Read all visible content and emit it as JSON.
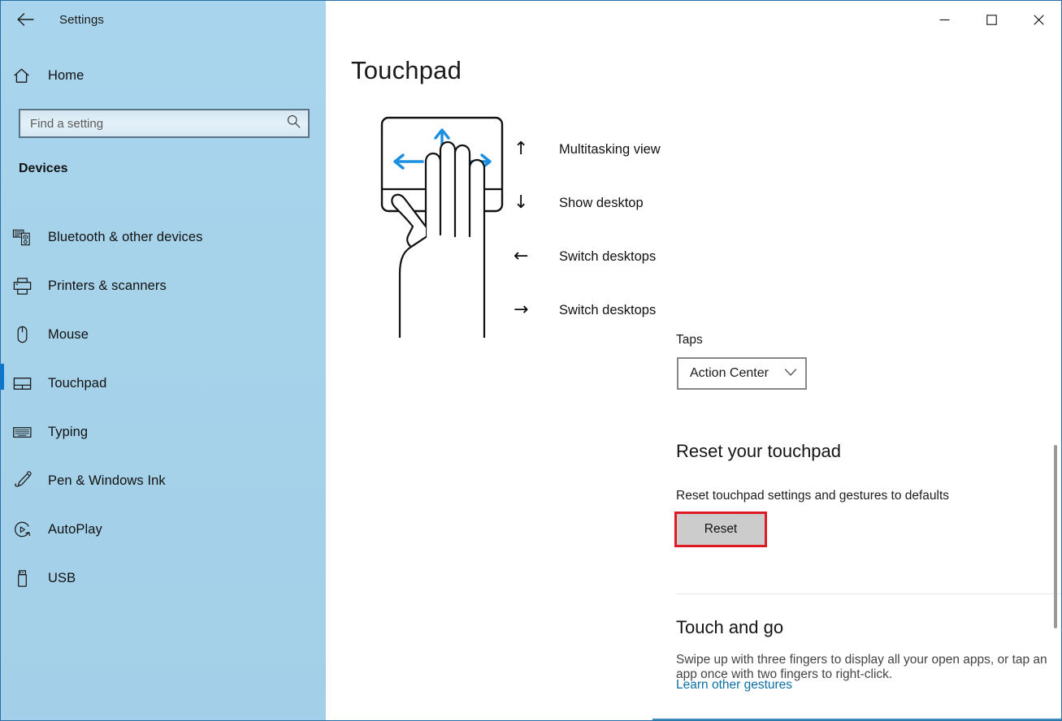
{
  "window": {
    "app_title": "Settings",
    "back_icon": "back-arrow-icon",
    "controls": {
      "minimize_label": "—",
      "maximize_label": "☐",
      "close_label": "✕"
    }
  },
  "sidebar": {
    "home": {
      "label": "Home",
      "icon": "home-icon"
    },
    "search": {
      "placeholder": "Find a setting",
      "value": "",
      "icon": "search-icon"
    },
    "group_header": "Devices",
    "items": [
      {
        "label": "Bluetooth & other devices",
        "icon": "bluetooth-devices-icon",
        "selected": false
      },
      {
        "label": "Printers & scanners",
        "icon": "printer-icon",
        "selected": false
      },
      {
        "label": "Mouse",
        "icon": "mouse-icon",
        "selected": false
      },
      {
        "label": "Touchpad",
        "icon": "touchpad-icon",
        "selected": true
      },
      {
        "label": "Typing",
        "icon": "keyboard-icon",
        "selected": false
      },
      {
        "label": "Pen & Windows Ink",
        "icon": "pen-icon",
        "selected": false
      },
      {
        "label": "AutoPlay",
        "icon": "autoplay-icon",
        "selected": false
      },
      {
        "label": "USB",
        "icon": "usb-icon",
        "selected": false
      }
    ],
    "accent_color": "#0078d4",
    "background_color": "#a8d5ed"
  },
  "main": {
    "page_title": "Touchpad",
    "diagram": {
      "name": "four-finger-gesture-diagram",
      "arrow_color": "#1a8fe0"
    },
    "gestures": [
      {
        "arrow": "↑",
        "arrow_name": "arrow-up-icon",
        "label": "Multitasking view"
      },
      {
        "arrow": "↓",
        "arrow_name": "arrow-down-icon",
        "label": "Show desktop"
      },
      {
        "arrow": "←",
        "arrow_name": "arrow-left-icon",
        "label": "Switch desktops"
      },
      {
        "arrow": "→",
        "arrow_name": "arrow-right-icon",
        "label": "Switch desktops"
      }
    ],
    "taps": {
      "label": "Taps",
      "selected": "Action Center",
      "chevron_icon": "chevron-down-icon"
    },
    "reset_section": {
      "title": "Reset your touchpad",
      "description": "Reset touchpad settings and gestures to defaults",
      "button_label": "Reset",
      "highlight_color": "#e01b24"
    },
    "touch_and_go": {
      "title": "Touch and go",
      "description": "Swipe up with three fingers to display all your open apps, or tap an app once with two fingers to right-click.",
      "link_label": "Learn other gestures",
      "link_color": "#0b6fa4"
    }
  }
}
